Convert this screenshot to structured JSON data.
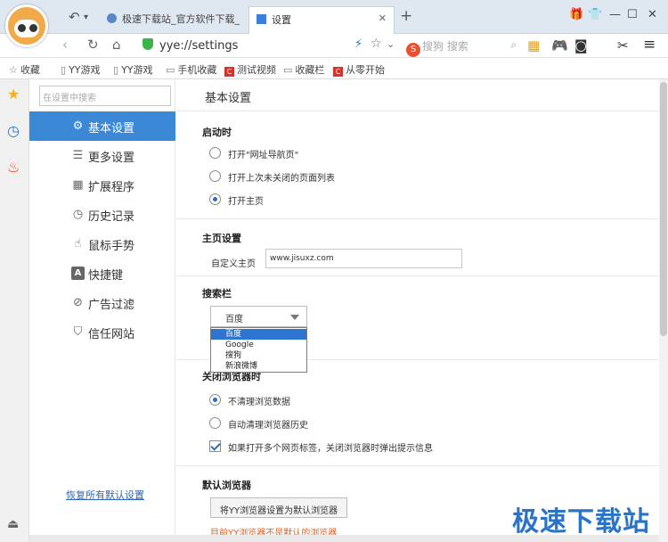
{
  "tabs": [
    {
      "label": "极速下载站_官方软件下载_"
    },
    {
      "label": "设置"
    }
  ],
  "window_controls": {
    "minimize": "—",
    "maximize": "☐",
    "close": "✕"
  },
  "address": {
    "url": "yye://settings"
  },
  "search": {
    "placeholder": "搜狗 搜索",
    "engine_badge": "S"
  },
  "bookmarks": [
    {
      "label": "收藏"
    },
    {
      "label": "YY游戏"
    },
    {
      "label": "YY游戏"
    },
    {
      "label": "手机收藏"
    },
    {
      "label": "测试视频"
    },
    {
      "label": "收藏栏"
    },
    {
      "label": "从零开始"
    }
  ],
  "settings_search": {
    "placeholder": "在设置中搜索"
  },
  "sidebar": {
    "items": [
      {
        "label": "基本设置",
        "active": true
      },
      {
        "label": "更多设置"
      },
      {
        "label": "扩展程序"
      },
      {
        "label": "历史记录"
      },
      {
        "label": "鼠标手势"
      },
      {
        "label": "快捷键"
      },
      {
        "label": "广告过滤"
      },
      {
        "label": "信任网站"
      }
    ],
    "restore_label": "恢复所有默认设置"
  },
  "main": {
    "title": "基本设置",
    "startup": {
      "heading": "启动时",
      "options": [
        "打开\"网址导航页\"",
        "打开上次未关闭的页面列表",
        "打开主页"
      ],
      "selected": 2
    },
    "homepage": {
      "heading": "主页设置",
      "label": "自定义主页",
      "value": "www.jisuxz.com"
    },
    "searchbar": {
      "heading": "搜索栏",
      "selected": "百度",
      "options": [
        "百度",
        "Google",
        "搜狗",
        "新浪微博"
      ]
    },
    "close_browser": {
      "heading": "关闭浏览器时",
      "options": [
        "不清理浏览数据",
        "自动清理浏览器历史"
      ],
      "selected": 0,
      "checkbox_label": "如果打开多个网页标签，关闭浏览器时弹出提示信息",
      "checkbox_checked": true
    },
    "default_browser": {
      "heading": "默认浏览器",
      "button_label": "将YY浏览器设置为默认浏览器",
      "warning": "目前YY浏览器不是默认的浏览器"
    }
  },
  "watermark": "极速下载站",
  "colors": {
    "accent": "#3b88d6",
    "warning": "#e06020",
    "watermark": "#2a74c8"
  }
}
